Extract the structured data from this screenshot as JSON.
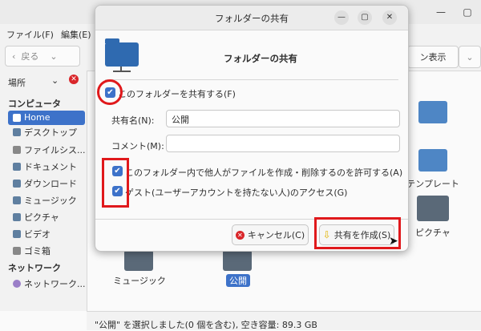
{
  "background_window": {
    "menu": [
      "ファイル(F)",
      "編集(E)"
    ],
    "back_label": "戻る",
    "view_label": "ン表示",
    "sidebar": {
      "places_label": "場所",
      "computer_header": "コンピュータ",
      "items": [
        "Home",
        "デスクトップ",
        "ファイルシス...",
        "ドキュメント",
        "ダウンロード",
        "ミュージック",
        "ピクチャ",
        "ビデオ",
        "ゴミ箱"
      ],
      "network_header": "ネットワーク",
      "network_items": [
        "ネットワーク..."
      ]
    },
    "files": [
      "テンプレート",
      "ピクチャ",
      "ミュージック",
      "公開"
    ],
    "status": "\"公開\" を選択しました(0 個を含む), 空き容量: 89.3 GB"
  },
  "dialog": {
    "title": "フォルダーの共有",
    "header": "フォルダーの共有",
    "share_checkbox_label": "このフォルダーを共有する(F)",
    "share_name_label": "共有名(N):",
    "share_name_value": "公開",
    "comment_label": "コメント(M):",
    "comment_value": "",
    "allow_others_label": "このフォルダー内で他人がファイルを作成・削除するのを許可する(A)",
    "guest_label": "ゲスト(ユーザーアカウントを持たない人)のアクセス(G)",
    "cancel_label": "キャンセル(C)",
    "create_label": "共有を作成(S)"
  },
  "colors": {
    "accent": "#3d72c9",
    "highlight": "#e0191c"
  }
}
